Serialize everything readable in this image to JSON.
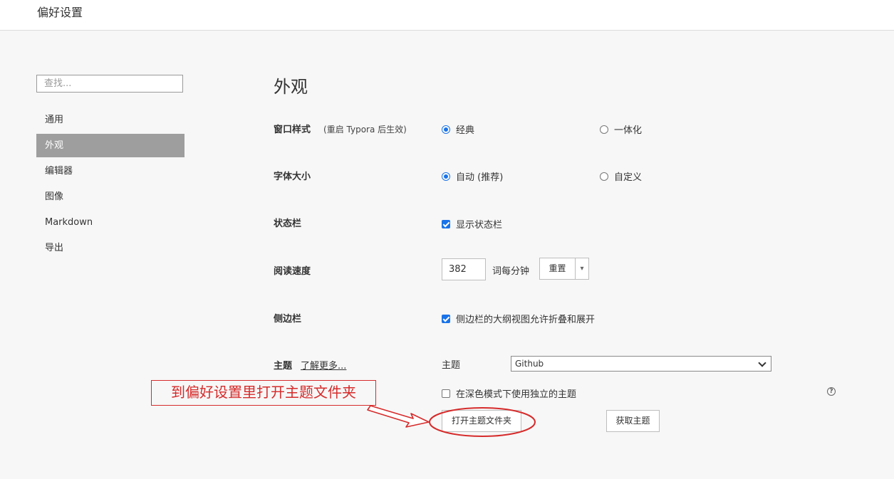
{
  "window": {
    "title": "偏好设置"
  },
  "search": {
    "placeholder": "查找..."
  },
  "sidebar": {
    "items": [
      {
        "label": "通用"
      },
      {
        "label": "外观"
      },
      {
        "label": "编辑器"
      },
      {
        "label": "图像"
      },
      {
        "label": "Markdown"
      },
      {
        "label": "导出"
      }
    ],
    "active": "外观"
  },
  "main": {
    "heading": "外观",
    "window_style": {
      "label": "窗口样式",
      "note": "(重启 Typora 后生效)",
      "option_classic": "经典",
      "option_unified": "一体化",
      "selected": "经典"
    },
    "font_size": {
      "label": "字体大小",
      "option_auto": "自动 (推荐)",
      "option_custom": "自定义",
      "selected": "自动 (推荐)"
    },
    "status_bar": {
      "label": "状态栏",
      "checkbox": "显示状态栏",
      "checked": true
    },
    "reading_speed": {
      "label": "阅读速度",
      "value": "382",
      "unit": "词每分钟",
      "reset": "重置",
      "dropdown_glyph": "▾"
    },
    "sidebar_opt": {
      "label": "侧边栏",
      "checkbox": "侧边栏的大纲视图允许折叠和展开",
      "checked": true
    },
    "theme": {
      "label": "主题",
      "learn_more": "了解更多...",
      "select_label": "主题",
      "selected": "Github",
      "dark_mode_checkbox": "在深色模式下使用独立的主题",
      "dark_mode_checked": false,
      "help_glyph": "?",
      "open_folder_button": "打开主题文件夹",
      "get_themes_button": "获取主题"
    }
  },
  "annotation": {
    "text": "到偏好设置里打开主题文件夹",
    "color": "#d62b2b"
  },
  "colors": {
    "accent": "#1a73e8",
    "active_nav": "#9e9e9e",
    "annotation": "#d62b2b"
  }
}
